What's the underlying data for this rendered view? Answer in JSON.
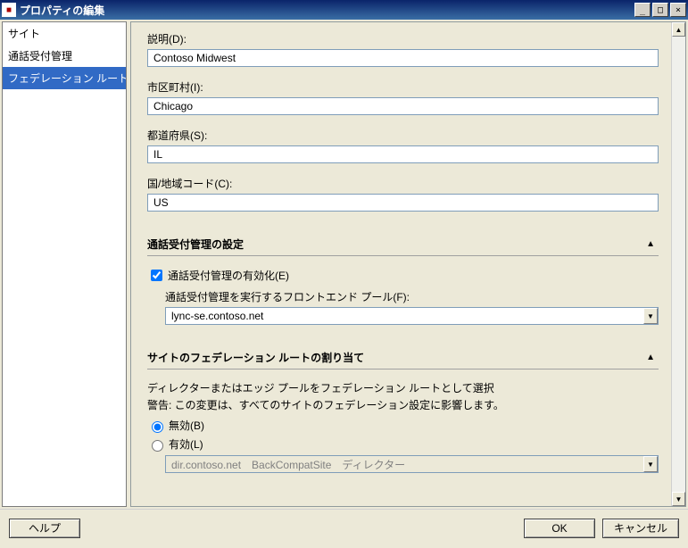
{
  "window": {
    "title": "プロパティの編集"
  },
  "sidebar": {
    "items": [
      {
        "label": "サイト"
      },
      {
        "label": "通話受付管理"
      },
      {
        "label": "フェデレーション ルート"
      }
    ]
  },
  "fields": {
    "description_label": "説明(D):",
    "description_value": "Contoso Midwest",
    "city_label": "市区町村(I):",
    "city_value": "Chicago",
    "state_label": "都道府県(S):",
    "state_value": "IL",
    "country_label": "国/地域コード(C):",
    "country_value": "US"
  },
  "cac": {
    "header": "通話受付管理の設定",
    "enable_label": "通話受付管理の有効化(E)",
    "pool_label": "通話受付管理を実行するフロントエンド プール(F):",
    "pool_value": "lync-se.contoso.net"
  },
  "fed": {
    "header": "サイトのフェデレーション ルートの割り当て",
    "hint": "ディレクターまたはエッジ プールをフェデレーション ルートとして選択",
    "warn": "警告: この変更は、すべてのサイトのフェデレーション設定に影響します。",
    "radio_disabled": "無効(B)",
    "radio_enabled": "有効(L)",
    "route_value": "dir.contoso.net　BackCompatSite　ディレクター"
  },
  "buttons": {
    "help": "ヘルプ",
    "ok": "OK",
    "cancel": "キャンセル"
  }
}
